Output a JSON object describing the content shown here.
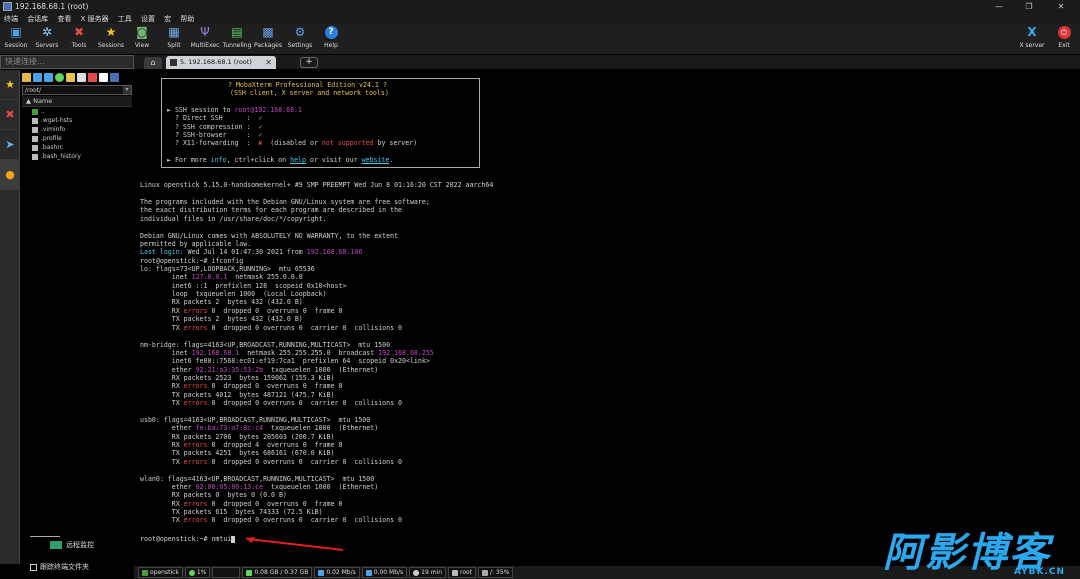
{
  "window": {
    "title": "192.168.68.1 (root)"
  },
  "menu": [
    "终端",
    "会话库",
    "查看",
    "X 服务器",
    "工具",
    "设置",
    "宏",
    "帮助"
  ],
  "toolbar": {
    "left": [
      {
        "label": "Session",
        "icon": "session-icon"
      },
      {
        "label": "Servers",
        "icon": "servers-icon"
      },
      {
        "label": "Tools",
        "icon": "tools-icon"
      },
      {
        "label": "Sessions",
        "icon": "sessions-star-icon"
      },
      {
        "label": "View",
        "icon": "view-icon"
      },
      {
        "label": "Split",
        "icon": "split-icon"
      },
      {
        "label": "MultiExec",
        "icon": "multiexec-icon"
      },
      {
        "label": "Tunneling",
        "icon": "tunneling-icon"
      },
      {
        "label": "Packages",
        "icon": "packages-icon"
      },
      {
        "label": "Settings",
        "icon": "settings-icon"
      },
      {
        "label": "Help",
        "icon": "help-icon"
      }
    ],
    "right": [
      {
        "label": "X server",
        "icon": "x-server-icon"
      },
      {
        "label": "Exit",
        "icon": "exit-icon"
      }
    ]
  },
  "sidebar": {
    "quick_connect_placeholder": "快速连接...",
    "path": "/root/",
    "column_header": "Name",
    "files": [
      "..",
      ".wget-hsts",
      ".viminfo",
      ".profile",
      ".bashrc",
      ".bash_history"
    ],
    "remote_monitor_label": "远程监控",
    "follow_terminal_label": "跟踪终端文件夹"
  },
  "tabs": {
    "session_tab_label": "5. 192.168.68.1 (root)"
  },
  "terminal": {
    "banner": {
      "title": "? MobaXterm Professional Edition v24.1 ?",
      "subtitle": "(SSH client, X server and network tools)",
      "ssh_session": "root@192.168.68.1",
      "direct_ssh": "? Direct SSH      :  ✓",
      "ssh_compression": "? SSH compression :  ✓",
      "ssh_browser": "? SSH-browser     :  ✓",
      "x11": "? X11-forwarding  :  ✘  (disabled or not supported by server)",
      "more_info": "For more info, ctrl+click on help or visit our website."
    },
    "prompt_command": "root@openstick:~# nmtui"
  },
  "statusbar": {
    "host": "openstick",
    "cpu": "1%",
    "mem": "0.08 GB / 0.37 GB",
    "upload": "0.02 Mb/s",
    "download": "0.00 Mb/s",
    "uptime": "19 min",
    "user": "root",
    "disk": "/: 35%"
  },
  "watermark": {
    "title": "阿影博客",
    "url": "AYBK.CN"
  }
}
